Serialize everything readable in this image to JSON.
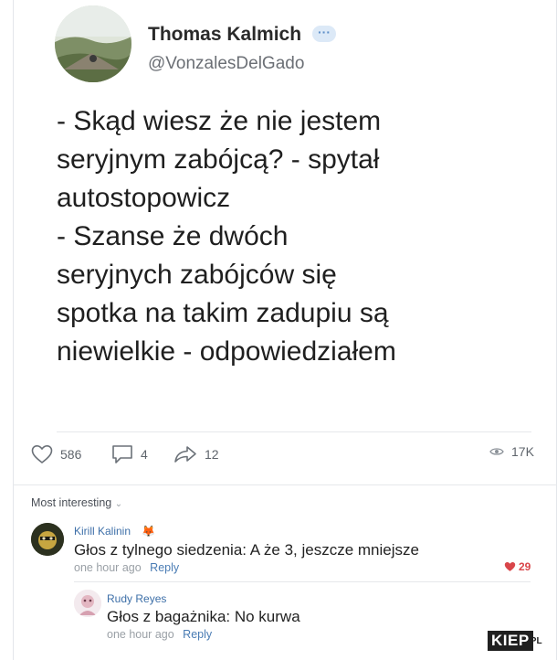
{
  "tweet": {
    "author_name": "Thomas Kalmich",
    "verified_glyph": "···",
    "handle": "@VonzalesDelGado",
    "lines": [
      "- Skąd wiesz że nie jestem",
      "seryjnym zabójcą? - spytał",
      "autostopowicz",
      "- Szanse że dwóch",
      "seryjnych zabójców się",
      "spotka na takim zadupiu są",
      "niewielkie - odpowiedziałem"
    ],
    "stats": {
      "likes": "586",
      "comments": "4",
      "shares": "12",
      "views": "17K"
    }
  },
  "comments_header": {
    "label": "Most interesting"
  },
  "comments": [
    {
      "author": "Kirill Kalinin",
      "text": "Głos z tylnego siedzenia: A że 3, jeszcze mniejsze",
      "time": "one hour ago",
      "reply": "Reply",
      "likes": "29"
    },
    {
      "author": "Rudy Reyes",
      "text": "Głos z bagażnika: No kurwa",
      "time": "one hour ago",
      "reply": "Reply"
    }
  ],
  "watermark": {
    "brand": "KIEP",
    "suffix": ".PL"
  },
  "icons": {
    "verified": "verified-badge-icon",
    "menu": "chevron-down-icon",
    "like": "heart-icon",
    "comment": "comment-bubble-icon",
    "share": "share-arrow-icon",
    "views": "eye-icon",
    "comment_like": "filled-heart-icon"
  },
  "colors": {
    "link": "#3d6fa8",
    "like_red": "#d9464a",
    "muted": "#9aa0a6"
  }
}
